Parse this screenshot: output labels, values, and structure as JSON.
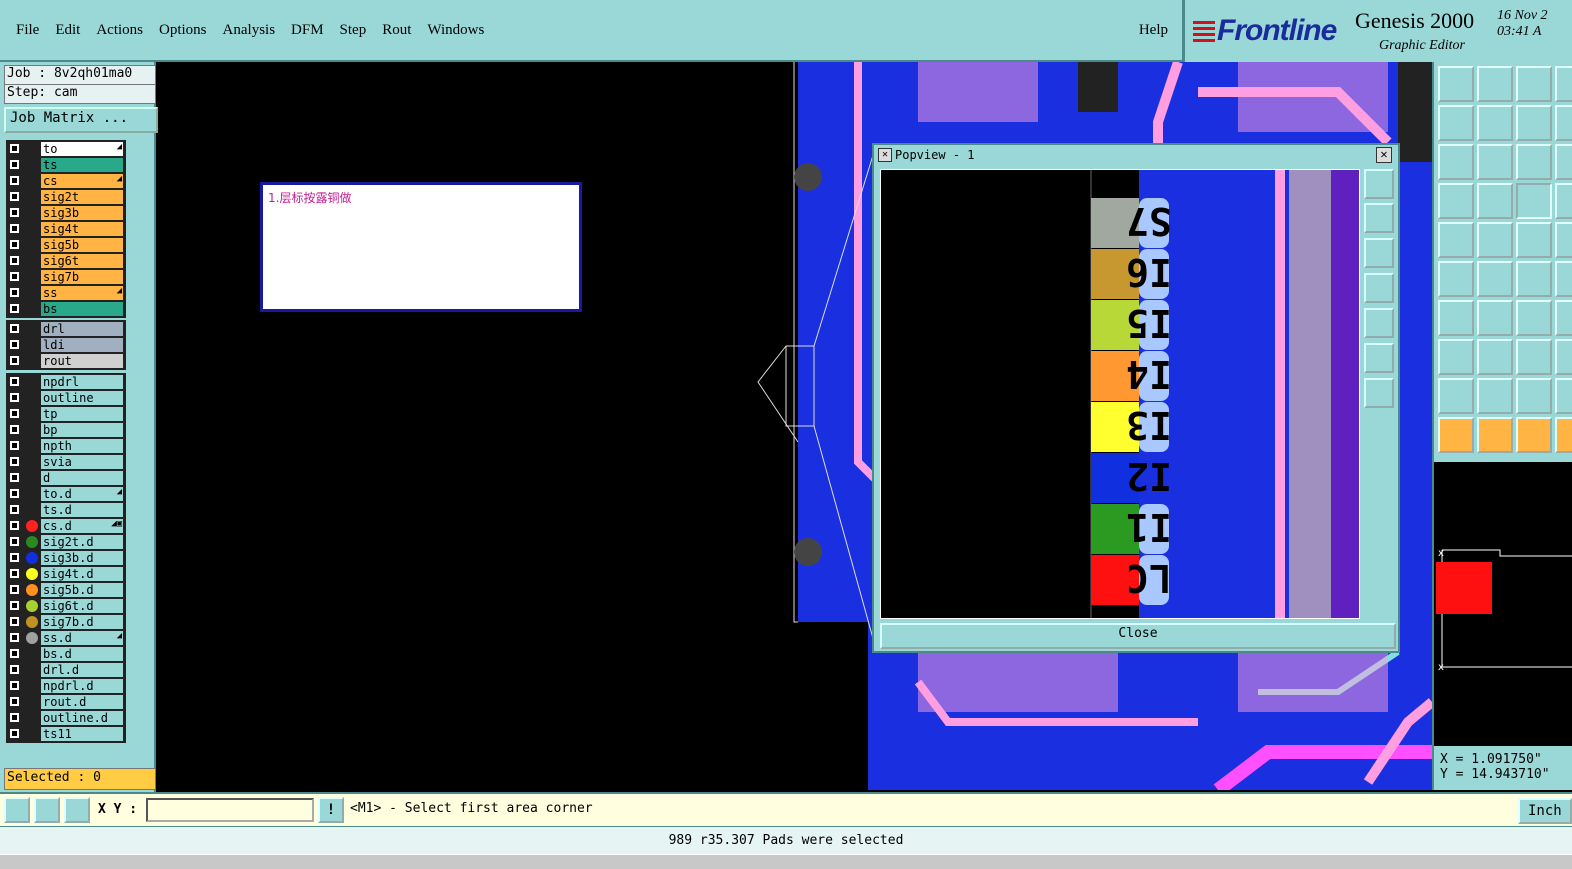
{
  "menu": {
    "items": [
      {
        "label": "File",
        "key": "File"
      },
      {
        "label": "Edit",
        "key": "Edit"
      },
      {
        "label": "Actions",
        "key": "Actions"
      },
      {
        "label": "Options",
        "key": "Options"
      },
      {
        "label": "Analysis",
        "key": "Analysis"
      },
      {
        "label": "DFM",
        "key": "DFM"
      },
      {
        "label": "Step",
        "key": "Step"
      },
      {
        "label": "Rout",
        "key": "Rout"
      },
      {
        "label": "Windows",
        "key": "Windows"
      }
    ],
    "help": "Help"
  },
  "brand": {
    "logo": "Frontline",
    "product": "Genesis 2000",
    "subtitle": "Graphic Editor",
    "date": "16 Nov 2\n03:41 A"
  },
  "job": {
    "job_line": "Job : 8v2qh01ma0",
    "step_line": "Step: cam",
    "matrix_button": "Job Matrix ..."
  },
  "layers": {
    "group1": [
      {
        "name": "to",
        "color": "#ffffff",
        "flag": "◢"
      },
      {
        "name": "ts",
        "color": "#2aa88a",
        "flag": ""
      },
      {
        "name": "cs",
        "color": "#ffb444",
        "flag": "◢"
      },
      {
        "name": "sig2t",
        "color": "#ffb444",
        "flag": ""
      },
      {
        "name": "sig3b",
        "color": "#ffb444",
        "flag": ""
      },
      {
        "name": "sig4t",
        "color": "#ffb444",
        "flag": ""
      },
      {
        "name": "sig5b",
        "color": "#ffb444",
        "flag": ""
      },
      {
        "name": "sig6t",
        "color": "#ffb444",
        "flag": ""
      },
      {
        "name": "sig7b",
        "color": "#ffb444",
        "flag": ""
      },
      {
        "name": "ss",
        "color": "#ffb444",
        "flag": "◢"
      },
      {
        "name": "bs",
        "color": "#2aa88a",
        "flag": ""
      }
    ],
    "group2": [
      {
        "name": "drl",
        "color": "#a0b0c0",
        "flag": ""
      },
      {
        "name": "ldi",
        "color": "#a0b0c0",
        "flag": ""
      },
      {
        "name": "rout",
        "color": "#d0d0d0",
        "flag": ""
      }
    ],
    "group3": [
      {
        "name": "npdrl",
        "color": "#9ad8d8",
        "dot": "",
        "flag": ""
      },
      {
        "name": "outline",
        "color": "#9ad8d8",
        "dot": "",
        "flag": ""
      },
      {
        "name": "tp",
        "color": "#9ad8d8",
        "dot": "",
        "flag": ""
      },
      {
        "name": "bp",
        "color": "#9ad8d8",
        "dot": "",
        "flag": ""
      },
      {
        "name": "npth",
        "color": "#9ad8d8",
        "dot": "",
        "flag": ""
      },
      {
        "name": "svia",
        "color": "#9ad8d8",
        "dot": "",
        "flag": ""
      },
      {
        "name": "d",
        "color": "#9ad8d8",
        "dot": "",
        "flag": ""
      },
      {
        "name": "to.d",
        "color": "#9ad8d8",
        "dot": "",
        "flag": "◢"
      },
      {
        "name": "ts.d",
        "color": "#9ad8d8",
        "dot": "",
        "flag": ""
      },
      {
        "name": "cs.d",
        "color": "#9ad8d8",
        "dot": "#ff2020",
        "flag": "◢▣"
      },
      {
        "name": "sig2t.d",
        "color": "#9ad8d8",
        "dot": "#2a8a20",
        "flag": ""
      },
      {
        "name": "sig3b.d",
        "color": "#9ad8d8",
        "dot": "#1030e0",
        "flag": ""
      },
      {
        "name": "sig4t.d",
        "color": "#9ad8d8",
        "dot": "#ffff20",
        "flag": ""
      },
      {
        "name": "sig5b.d",
        "color": "#9ad8d8",
        "dot": "#ff9020",
        "flag": ""
      },
      {
        "name": "sig6t.d",
        "color": "#9ad8d8",
        "dot": "#a8d030",
        "flag": ""
      },
      {
        "name": "sig7b.d",
        "color": "#9ad8d8",
        "dot": "#c09020",
        "flag": ""
      },
      {
        "name": "ss.d",
        "color": "#9ad8d8",
        "dot": "#a0a0a0",
        "flag": "◢"
      },
      {
        "name": "bs.d",
        "color": "#9ad8d8",
        "dot": "",
        "flag": ""
      },
      {
        "name": "drl.d",
        "color": "#9ad8d8",
        "dot": "",
        "flag": ""
      },
      {
        "name": "npdrl.d",
        "color": "#9ad8d8",
        "dot": "",
        "flag": ""
      },
      {
        "name": "rout.d",
        "color": "#9ad8d8",
        "dot": "",
        "flag": ""
      },
      {
        "name": "outline.d",
        "color": "#9ad8d8",
        "dot": "",
        "flag": ""
      },
      {
        "name": "ts11",
        "color": "#9ad8d8",
        "dot": "",
        "flag": ""
      }
    ]
  },
  "selected": "Selected : 0",
  "note": {
    "text": "1.层标按露铜做"
  },
  "popview": {
    "title": "Popview - 1",
    "close_label": "Close",
    "labels": [
      {
        "text": "S7",
        "bg": "#a0a8a0"
      },
      {
        "text": "I6",
        "bg": "#c89830"
      },
      {
        "text": "I5",
        "bg": "#b8d838"
      },
      {
        "text": "I4",
        "bg": "#ff9830"
      },
      {
        "text": "I3",
        "bg": "#ffff30"
      },
      {
        "text": "I2",
        "bg": "#1030e0"
      },
      {
        "text": "I1",
        "bg": "#2a9a20"
      },
      {
        "text": "LC",
        "bg": "#ff1010"
      }
    ]
  },
  "coords": {
    "x": "X = 1.091750\"",
    "y": "Y = 14.943710\""
  },
  "command": {
    "xy_label": "X Y :",
    "xy_value": "",
    "alert": "!",
    "prompt": "<M1> - Select first area corner",
    "units": "Inch"
  },
  "status": "989 r35.307 Pads were selected",
  "colors": {
    "panel": "#9ad8d8",
    "board": "#1a30e0",
    "accent_orange": "#ffb444"
  }
}
